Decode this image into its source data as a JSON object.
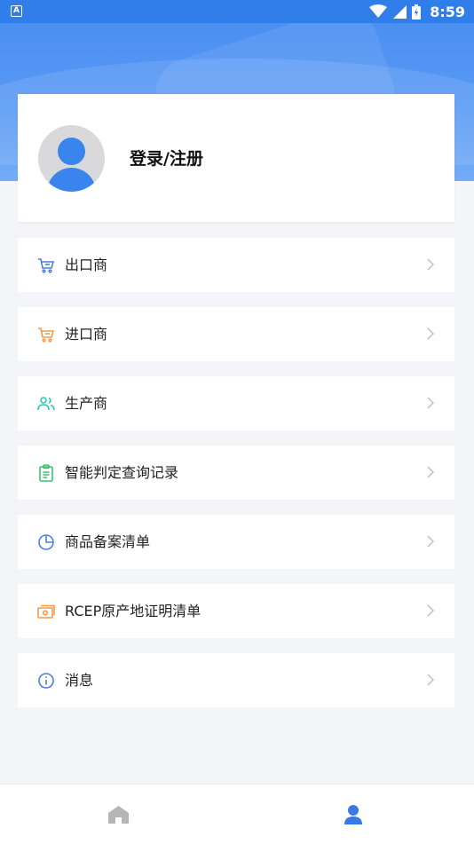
{
  "status_bar": {
    "app_badge": "A",
    "time": "8:59",
    "icons": [
      "wifi-icon",
      "signal-icon",
      "battery-icon"
    ]
  },
  "profile": {
    "login_label": "登录/注册",
    "avatar_icon": "user-avatar-icon"
  },
  "menu": {
    "items": [
      {
        "label": "出口商",
        "icon": "cart-icon",
        "color": "#4a7fe3"
      },
      {
        "label": "进口商",
        "icon": "cart-icon",
        "color": "#f29a4a"
      },
      {
        "label": "生产商",
        "icon": "users-icon",
        "color": "#2ec7b5"
      },
      {
        "label": "智能判定查询记录",
        "icon": "clipboard-icon",
        "color": "#3fbf6f"
      },
      {
        "label": "商品备案清单",
        "icon": "pie-chart-icon",
        "color": "#4a7fe3"
      },
      {
        "label": "RCEP原产地证明清单",
        "icon": "money-icon",
        "color": "#f29a4a"
      },
      {
        "label": "消息",
        "icon": "info-icon",
        "color": "#4a7fe3"
      }
    ]
  },
  "tabbar": {
    "tabs": [
      {
        "name": "home",
        "icon": "home-icon",
        "color": "#b5b5b5",
        "active": false
      },
      {
        "name": "mine",
        "icon": "user-icon",
        "color": "#3a78e8",
        "active": true
      }
    ]
  }
}
